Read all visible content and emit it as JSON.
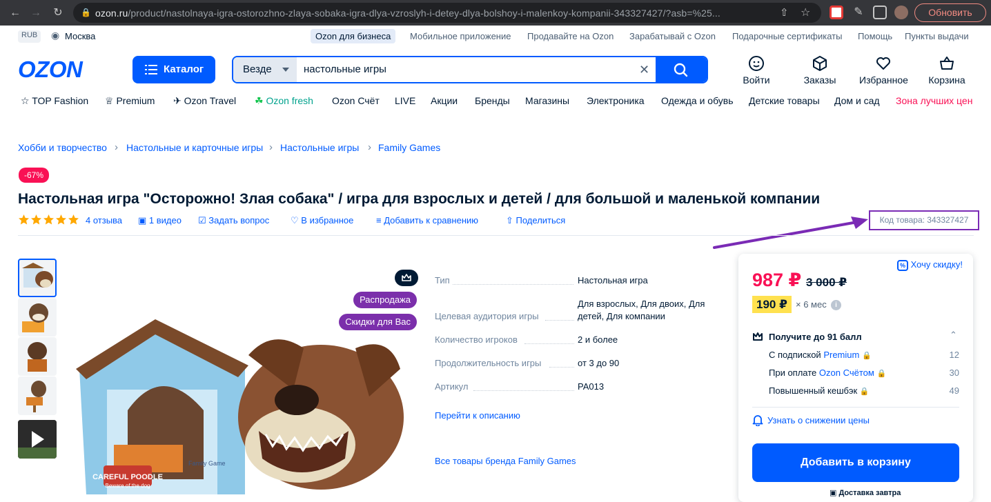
{
  "browser": {
    "url_host": "ozon.ru",
    "url_path": "/product/nastolnaya-igra-ostorozhno-zlaya-sobaka-igra-dlya-vzroslyh-i-detey-dlya-bolshoy-i-malenkoy-kompanii-343327427/?asb=%25...",
    "refresh_label": "Обновить"
  },
  "topbar": {
    "currency": "RUB",
    "city": "Москва",
    "links": [
      "Ozon для бизнеса",
      "Мобильное приложение",
      "Продавайте на Ozon",
      "Зарабатывай с Ozon",
      "Подарочные сертификаты",
      "Помощь",
      "Пункты выдачи"
    ]
  },
  "header": {
    "logo": "OZON",
    "catalog_label": "Каталог",
    "search_scope": "Везде",
    "search_query": "настольные игры",
    "icons": [
      "Войти",
      "Заказы",
      "Избранное",
      "Корзина"
    ]
  },
  "categories": [
    "TOP Fashion",
    "Premium",
    "Ozon Travel",
    "Ozon fresh",
    "Ozon Счёт",
    "LIVE",
    "Акции",
    "Бренды",
    "Магазины",
    "Электроника",
    "Одежда и обувь",
    "Детские товары",
    "Дом и сад",
    "Зона лучших цен"
  ],
  "breadcrumbs": [
    "Хобби и творчество",
    "Настольные и карточные игры",
    "Настольные игры",
    "Family Games"
  ],
  "product": {
    "discount_badge": "-67%",
    "title": "Настольная игра \"Осторожно! Злая собака\" / игра для взрослых и детей / для большой и маленькой компании",
    "rating": 5,
    "reviews": "4 отзыва",
    "video": "1 видео",
    "ask": "Задать вопрос",
    "favorite": "В избранное",
    "compare": "Добавить к сравнению",
    "share": "Поделиться",
    "sku": "Код товара: 343327427",
    "badges": [
      "Распродажа",
      "Скидки для Вас"
    ],
    "box_text_1": "CAREFUL POODLE",
    "box_text_2": "Beware of the dog",
    "box_text_3": "Family Game"
  },
  "specs": [
    {
      "label": "Тип",
      "value": "Настольная игра"
    },
    {
      "label": "Целевая аудитория игры",
      "value": "Для взрослых, Для двоих, Для детей, Для компании"
    },
    {
      "label": "Количество игроков",
      "value": "2 и более"
    },
    {
      "label": "Продолжительность игры",
      "value": "от 3 до 90"
    },
    {
      "label": "Артикул",
      "value": "PA013"
    }
  ],
  "spec_links": {
    "description": "Перейти к описанию",
    "brand": "Все товары бренда Family Games"
  },
  "price_card": {
    "want_discount": "Хочу скидку!",
    "price": "987 ₽",
    "old_price": "3 000 ₽",
    "installment": "190 ₽",
    "installment_months": "× 6 мес",
    "bonus_title": "Получите до 91 балл",
    "bonus_rows": [
      {
        "text": "С подпиской ",
        "link": "Premium",
        "value": "12"
      },
      {
        "text": "При оплате ",
        "link": "Ozon Счётом",
        "value": "30"
      },
      {
        "text": "Повышенный кешбэк",
        "link": "",
        "value": "49"
      }
    ],
    "notify": "Узнать о снижении цены",
    "add_to_cart": "Добавить в корзину",
    "delivery": "Доставка завтра"
  },
  "colors": {
    "brand": "#005bff",
    "accent": "#f91155",
    "badge_purple": "#7b2fab",
    "highlight_box": "#7a2bb5"
  }
}
